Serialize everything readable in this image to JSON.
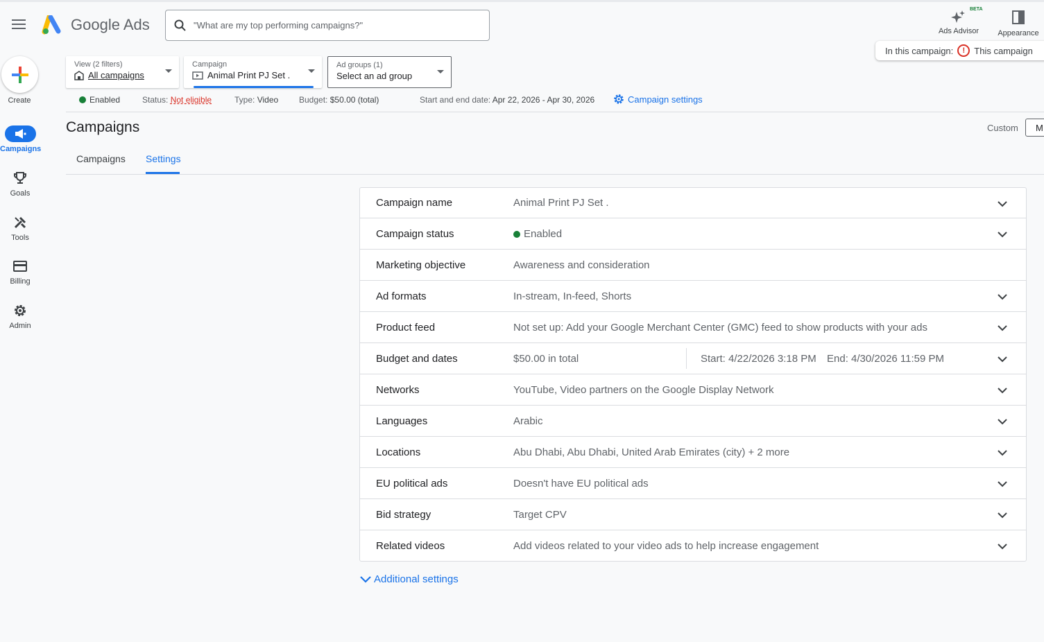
{
  "header": {
    "brand": "Google Ads",
    "search_placeholder": "\"What are my top performing campaigns?\"",
    "ads_advisor_label": "Ads Advisor",
    "beta_label": "BETA",
    "appearance_label": "Appearance",
    "banner_prefix": "In this campaign:",
    "banner_text": "This campaign"
  },
  "nav": {
    "create": "Create",
    "campaigns": "Campaigns",
    "goals": "Goals",
    "tools": "Tools",
    "billing": "Billing",
    "admin": "Admin"
  },
  "filters": {
    "view_label": "View (2 filters)",
    "view_value": "All campaigns",
    "campaign_label": "Campaign",
    "campaign_value": "Animal Print PJ Set .",
    "adgroups_label": "Ad groups (1)",
    "adgroups_value": "Select an ad group"
  },
  "statusbar": {
    "enabled": "Enabled",
    "status_label": "Status:",
    "status_value": "Not eligible",
    "type_label": "Type:",
    "type_value": "Video",
    "budget_label": "Budget:",
    "budget_value": "$50.00 (total)",
    "dates_label": "Start and end date:",
    "dates_value": "Apr 22, 2026 - Apr 30, 2026",
    "campaign_settings": "Campaign settings"
  },
  "page": {
    "title": "Campaigns",
    "custom_label": "Custom",
    "custom_box": "M",
    "tabs": [
      "Campaigns",
      "Settings"
    ]
  },
  "settings": [
    {
      "name": "Campaign name",
      "value": "Animal Print PJ Set ."
    },
    {
      "name": "Campaign status",
      "value": "Enabled"
    },
    {
      "name": "Marketing objective",
      "value": "Awareness and consideration"
    },
    {
      "name": "Ad formats",
      "value": "In-stream, In-feed, Shorts"
    },
    {
      "name": "Product feed",
      "value": "Not set up: Add your Google Merchant Center (GMC) feed to show products with your ads"
    },
    {
      "name": "Budget and dates",
      "value": "$50.00 in total",
      "start": "Start: 4/22/2026 3:18 PM",
      "end": "End: 4/30/2026 11:59 PM"
    },
    {
      "name": "Networks",
      "value": "YouTube, Video partners on the Google Display Network"
    },
    {
      "name": "Languages",
      "value": "Arabic"
    },
    {
      "name": "Locations",
      "value": "Abu Dhabi, Abu Dhabi, United Arab Emirates (city) + 2 more"
    },
    {
      "name": "EU political ads",
      "value": "Doesn't have EU political ads"
    },
    {
      "name": "Bid strategy",
      "value": "Target CPV"
    },
    {
      "name": "Related videos",
      "value": "Add videos related to your video ads to help increase engagement"
    }
  ],
  "additional_settings": "Additional settings",
  "colors": {
    "accent": "#1a73e8",
    "enabled_green": "#188038",
    "error_red": "#d93025"
  }
}
